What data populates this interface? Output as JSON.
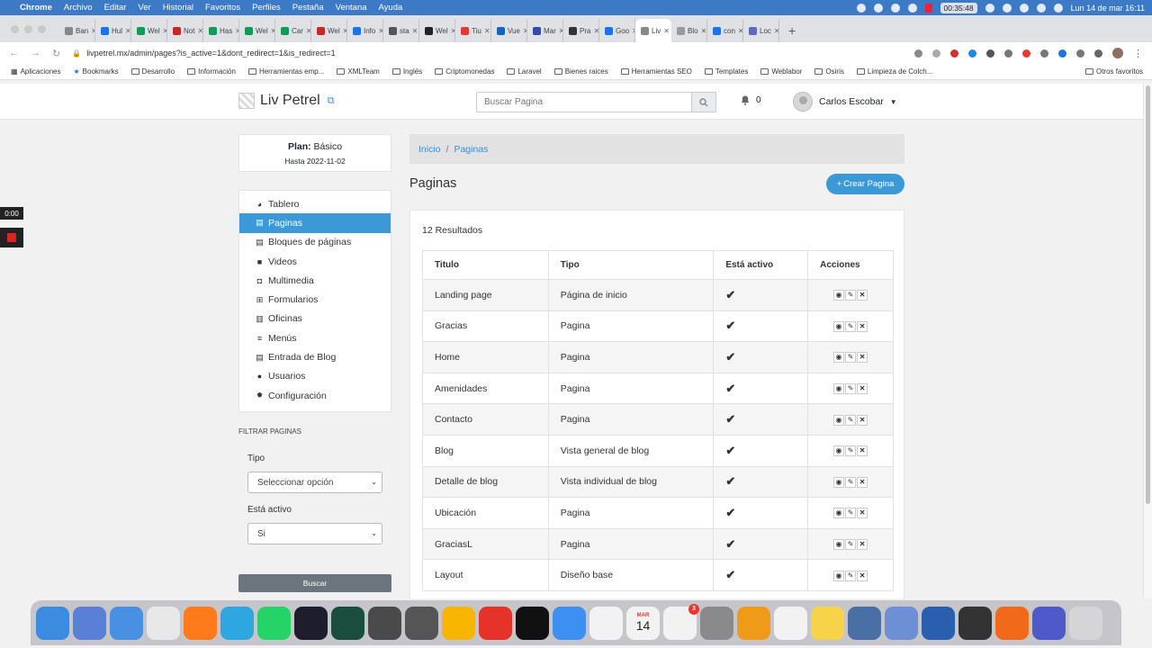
{
  "menubar": {
    "app": "Chrome",
    "items": [
      "Archivo",
      "Editar",
      "Ver",
      "Historial",
      "Favoritos",
      "Perfiles",
      "Pestaña",
      "Ventana",
      "Ayuda"
    ],
    "timer": "00:35:48",
    "datetime": "Lun 14 de mar  16:11"
  },
  "tabs": [
    {
      "label": "Ban",
      "color": "#888"
    },
    {
      "label": "Hul",
      "color": "#1a73e8"
    },
    {
      "label": "Wel",
      "color": "#0f9d58"
    },
    {
      "label": "Not",
      "color": "#c62828"
    },
    {
      "label": "Has",
      "color": "#0f9d58"
    },
    {
      "label": "Wel",
      "color": "#0f9d58"
    },
    {
      "label": "Car",
      "color": "#0f9d58"
    },
    {
      "label": "Wel",
      "color": "#c62828"
    },
    {
      "label": "Info",
      "color": "#1a73e8"
    },
    {
      "label": "sta",
      "color": "#555"
    },
    {
      "label": "Wel",
      "color": "#222"
    },
    {
      "label": "Tiu",
      "color": "#e53935"
    },
    {
      "label": "Vue",
      "color": "#1565c0"
    },
    {
      "label": "Mar",
      "color": "#3949ab"
    },
    {
      "label": "Pra",
      "color": "#333"
    },
    {
      "label": "Goo",
      "color": "#1a73e8"
    },
    {
      "label": "Liv",
      "color": "#888",
      "active": true
    },
    {
      "label": "Blo",
      "color": "#999"
    },
    {
      "label": "con",
      "color": "#1a73e8"
    },
    {
      "label": "Loc",
      "color": "#5c6bc0"
    }
  ],
  "address": {
    "url": "livpetrel.mx/admin/pages?is_active=1&dont_redirect=1&is_redirect=1"
  },
  "bookmarks": {
    "items": [
      "Aplicaciones",
      "Bookmarks",
      "Desarrollo",
      "Información",
      "Herramientas emp...",
      "XMLTeam",
      "Inglés",
      "Criptomonedas",
      "Laravel",
      "Bienes raices",
      "Herramientas SEO",
      "Templates",
      "Weblabor",
      "Osiris",
      "Limpieza de Colch..."
    ],
    "others": "Otros favoritos"
  },
  "header": {
    "brand": "Liv Petrel",
    "search_placeholder": "Buscar Pagina",
    "notifications": "0",
    "user": "Carlos Escobar"
  },
  "plan": {
    "label": "Plan:",
    "value": "Básico",
    "until": "Hasta 2022-11-02"
  },
  "sidebar": {
    "items": [
      {
        "label": "Tablero",
        "icon": "palette-icon"
      },
      {
        "label": "Paginas",
        "icon": "file-icon",
        "active": true
      },
      {
        "label": "Bloques de páginas",
        "icon": "file-icon"
      },
      {
        "label": "Videos",
        "icon": "video-icon"
      },
      {
        "label": "Multimedia",
        "icon": "camera-icon"
      },
      {
        "label": "Formularios",
        "icon": "form-icon"
      },
      {
        "label": "Oficinas",
        "icon": "building-icon"
      },
      {
        "label": "Menús",
        "icon": "bars-icon"
      },
      {
        "label": "Entrada de Blog",
        "icon": "file-icon"
      },
      {
        "label": "Usuarios",
        "icon": "user-icon"
      },
      {
        "label": "Configuración",
        "icon": "gear-icon"
      }
    ]
  },
  "filter": {
    "title": "FILTRAR PAGINAS",
    "tipo_label": "Tipo",
    "tipo_value": "Seleccionar opción",
    "activo_label": "Está activo",
    "activo_value": "Si",
    "button": "Buscar"
  },
  "main": {
    "breadcrumb": [
      "Inicio",
      "Paginas"
    ],
    "title": "Paginas",
    "create_button": "Crear Pagina",
    "results": "12 Resultados",
    "columns": [
      "Titulo",
      "Tipo",
      "Está activo",
      "Acciones"
    ],
    "rows": [
      {
        "title": "Landing page",
        "type": "Página de inicio",
        "active": "✔"
      },
      {
        "title": "Gracias",
        "type": "Pagina",
        "active": "✔"
      },
      {
        "title": "Home",
        "type": "Pagina",
        "active": "✔"
      },
      {
        "title": "Amenidades",
        "type": "Pagina",
        "active": "✔"
      },
      {
        "title": "Contacto",
        "type": "Pagina",
        "active": "✔"
      },
      {
        "title": "Blog",
        "type": "Vista general de blog",
        "active": "✔"
      },
      {
        "title": "Detalle de blog",
        "type": "Vista individual de blog",
        "active": "✔"
      },
      {
        "title": "Ubicación",
        "type": "Pagina",
        "active": "✔"
      },
      {
        "title": "GraciasL",
        "type": "Pagina",
        "active": "✔"
      },
      {
        "title": "Layout",
        "type": "Diseño base",
        "active": "✔"
      }
    ]
  },
  "overlay": {
    "time": "0:00"
  },
  "dock": [
    {
      "name": "finder-icon",
      "color": "#3b8be0"
    },
    {
      "name": "launchpad-icon",
      "color": "#5a7fd6"
    },
    {
      "name": "apps-icon",
      "color": "#4a90e2"
    },
    {
      "name": "chrome-icon",
      "color": "#e8e8e8"
    },
    {
      "name": "firefox-icon",
      "color": "#ff7a1a"
    },
    {
      "name": "telegram-icon",
      "color": "#2ea6df"
    },
    {
      "name": "whatsapp-icon",
      "color": "#25d366"
    },
    {
      "name": "phpstorm-icon",
      "color": "#1d1d2b"
    },
    {
      "name": "gitkraken-icon",
      "color": "#1b4d3e"
    },
    {
      "name": "sublime-icon",
      "color": "#4a4a4a"
    },
    {
      "name": "settings-tool-icon",
      "color": "#555"
    },
    {
      "name": "sketch-icon",
      "color": "#f7b500"
    },
    {
      "name": "anydesk-icon",
      "color": "#e6332a"
    },
    {
      "name": "terminal-icon",
      "color": "#111"
    },
    {
      "name": "mail-icon",
      "color": "#3d8ff2"
    },
    {
      "name": "photos-icon",
      "color": "#f2f2f2"
    },
    {
      "name": "calendar-icon",
      "color": "#f2f2f2"
    },
    {
      "name": "reminders-icon",
      "color": "#f2f2f2"
    },
    {
      "name": "system-prefs-icon",
      "color": "#8a8a8a"
    },
    {
      "name": "pages-icon",
      "color": "#f09a1a"
    },
    {
      "name": "textedit-icon",
      "color": "#f2f2f2"
    },
    {
      "name": "notes-icon",
      "color": "#f7d34a"
    },
    {
      "name": "preview-icon",
      "color": "#4a6fa5"
    },
    {
      "name": "database-icon",
      "color": "#6c8fd6"
    },
    {
      "name": "monitor-icon",
      "color": "#2a5fb0"
    },
    {
      "name": "calculator-icon",
      "color": "#333"
    },
    {
      "name": "sequel-icon",
      "color": "#f06a1a"
    },
    {
      "name": "teams-icon",
      "color": "#5059c9"
    },
    {
      "name": "trash-icon",
      "color": "#d5d5d8"
    }
  ],
  "dock_labels": {
    "calendar_month": "MAR",
    "calendar_day": "14",
    "reminders_badge": "3"
  }
}
